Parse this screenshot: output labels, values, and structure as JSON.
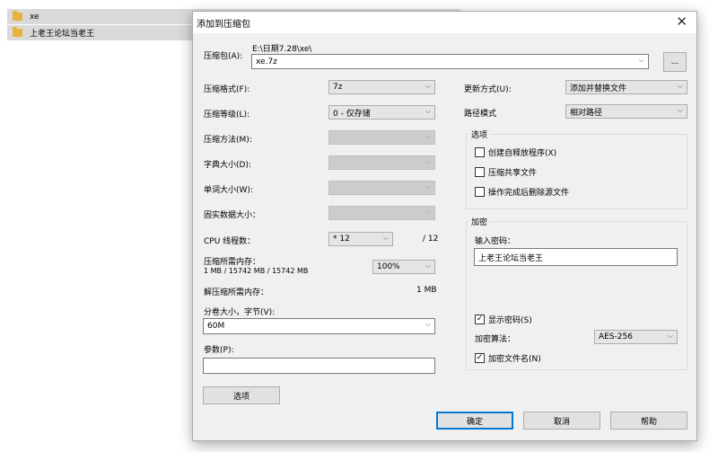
{
  "explorer": {
    "items": [
      {
        "label": "xe"
      },
      {
        "label": "上老王论坛当老王"
      }
    ]
  },
  "dialog": {
    "title": "添加到压缩包",
    "close": "✕",
    "archive": {
      "label": "压缩包(A):",
      "path": "E:\\日期7.28\\xe\\",
      "value": "xe.7z",
      "browse": "..."
    },
    "left": {
      "format": {
        "label": "压缩格式(F):",
        "value": "7z"
      },
      "level": {
        "label": "压缩等级(L):",
        "value": "0 - 仅存储"
      },
      "method": {
        "label": "压缩方法(M):",
        "value": ""
      },
      "dict": {
        "label": "字典大小(D):",
        "value": ""
      },
      "word": {
        "label": "单词大小(W):",
        "value": ""
      },
      "solid": {
        "label": "固实数据大小：",
        "value": ""
      },
      "threads": {
        "label": "CPU 线程数：",
        "value": "* 12",
        "max": "/ 12"
      },
      "mem_comp": {
        "label": "压缩所需内存：",
        "detail": "1 MB / 15742 MB / 15742 MB",
        "value": "100%"
      },
      "mem_decomp": {
        "label": "解压缩所需内存：",
        "value": "1 MB"
      },
      "split": {
        "label": "分卷大小，字节(V):",
        "value": "60M"
      },
      "params": {
        "label": "参数(P):",
        "value": ""
      },
      "options_button": "选项"
    },
    "right": {
      "update": {
        "label": "更新方式(U):",
        "value": "添加并替换文件"
      },
      "pathmode": {
        "label": "路径模式",
        "value": "相对路径"
      },
      "options_group": {
        "title": "选项",
        "sfx": {
          "label": "创建自释放程序(X)",
          "checked": false
        },
        "shared": {
          "label": "压缩共享文件",
          "checked": false
        },
        "delete": {
          "label": "操作完成后删除源文件",
          "checked": false
        }
      },
      "encryption": {
        "title": "加密",
        "password_label": "输入密码：",
        "password_value": "上老王论坛当老王",
        "show_password": {
          "label": "显示密码(S)",
          "checked": true
        },
        "method_label": "加密算法：",
        "method_value": "AES-256",
        "encrypt_names": {
          "label": "加密文件名(N)",
          "checked": true
        }
      }
    },
    "buttons": {
      "ok": "确定",
      "cancel": "取消",
      "help": "帮助"
    },
    "icons": {
      "arrow": "⌵",
      "check": "✓"
    }
  }
}
